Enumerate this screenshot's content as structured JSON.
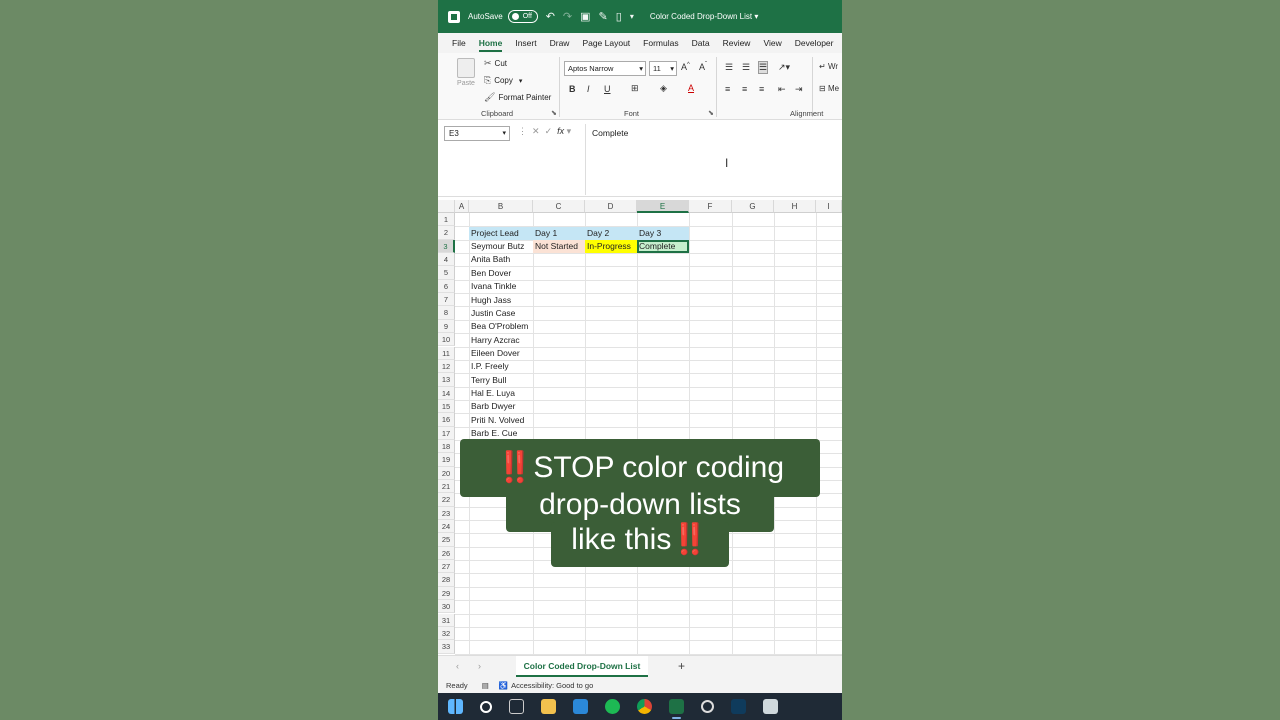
{
  "titlebar": {
    "autosave_label": "AutoSave",
    "autosave_state": "Off",
    "doc_title": "Color Coded Drop-Down List"
  },
  "tabs": [
    "File",
    "Home",
    "Insert",
    "Draw",
    "Page Layout",
    "Formulas",
    "Data",
    "Review",
    "View",
    "Developer"
  ],
  "active_tab": "Home",
  "ribbon": {
    "paste_label": "Paste",
    "cut_label": "Cut",
    "copy_label": "Copy",
    "format_painter_label": "Format Painter",
    "clipboard_label": "Clipboard",
    "font_name": "Aptos Narrow",
    "font_size": "11",
    "font_label": "Font",
    "alignment_label": "Alignment",
    "wrap_label": "Wr",
    "merge_label": "Me"
  },
  "formula_bar": {
    "name_box": "E3",
    "content": "Complete"
  },
  "columns": [
    "A",
    "B",
    "C",
    "D",
    "E",
    "F",
    "G",
    "H",
    "I"
  ],
  "row_numbers": [
    "1",
    "2",
    "3",
    "4",
    "5",
    "6",
    "7",
    "8",
    "9",
    "10",
    "11",
    "12",
    "13",
    "14",
    "15",
    "16",
    "17",
    "18",
    "19",
    "20",
    "21",
    "22",
    "23",
    "24",
    "25",
    "26",
    "27",
    "28",
    "29",
    "30",
    "31",
    "32",
    "33"
  ],
  "cells": {
    "header": {
      "b": "Project Lead",
      "c": "Day 1",
      "d": "Day 2",
      "e": "Day 3"
    },
    "row3": {
      "c": "Not Started",
      "d": "In-Progress",
      "e": "Complete"
    },
    "leads": [
      "Seymour Butz",
      "Anita Bath",
      "Ben Dover",
      "Ivana Tinkle",
      "Hugh Jass",
      "Justin Case",
      "Bea O'Problem",
      "Harry Azcrac",
      "Eileen Dover",
      "I.P. Freely",
      "Terry Bull",
      "Hal E. Luya",
      "Barb Dwyer",
      "Priti N. Volved",
      "Barb E. Cue"
    ]
  },
  "caption": {
    "line1": "STOP color coding",
    "line2": "drop-down lists",
    "line3": "like this",
    "emoji": "‼️"
  },
  "sheet_tab": "Color Coded Drop-Down List",
  "status": {
    "ready": "Ready",
    "accessibility": "Accessibility: Good to go"
  },
  "colors": {
    "excel_green": "#1e7145",
    "header_fill": "#c5e6f5",
    "not_started_fill": "#fbe2d5",
    "in_progress_fill": "#ffff00",
    "complete_fill": "#c6efce",
    "caption_bg": "#3b5e37",
    "background": "#6c8a65"
  }
}
